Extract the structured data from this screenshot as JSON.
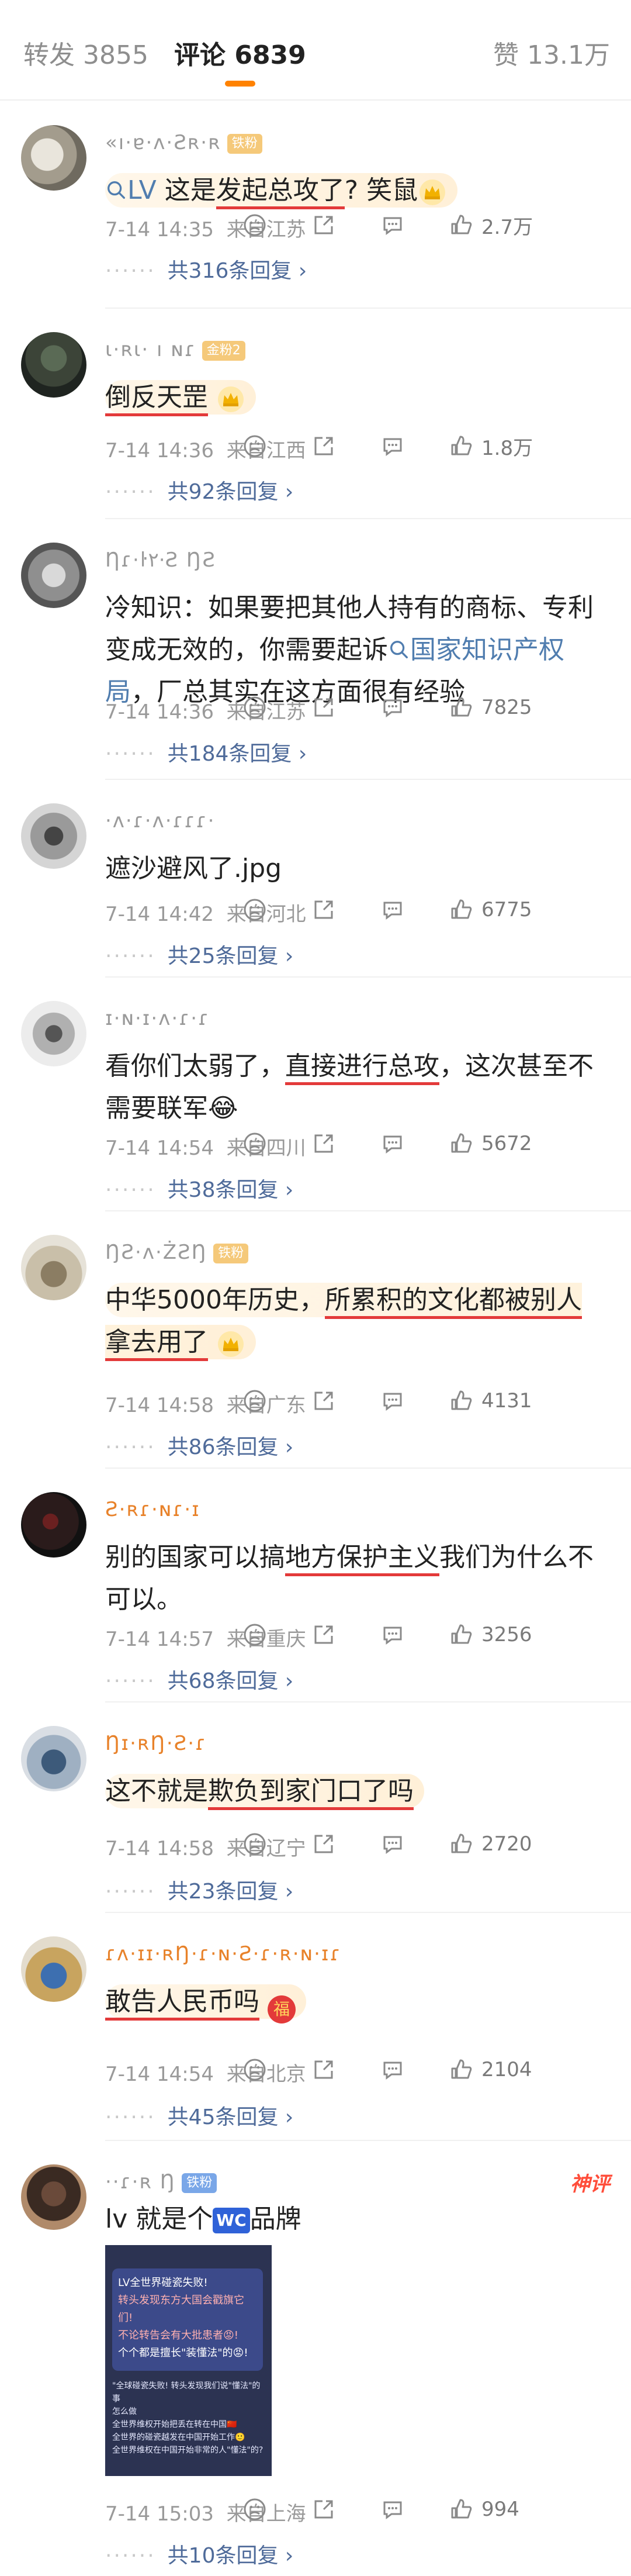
{
  "tabs": {
    "repost_label": "转发",
    "repost_count": "3855",
    "comment_label": "评论",
    "comment_count": "6839",
    "like_label": "赞",
    "like_count": "13.1万"
  },
  "comments": [
    {
      "username": "«ı·ɐ·ʌ·Ƨʀ·ʀ",
      "badge": "铁粉",
      "content": [
        "",
        "LV",
        " 这是",
        "发起总攻了",
        "? 笑鼠"
      ],
      "time": "7-14 14:35",
      "location": "来自江苏",
      "likes": "2.7万",
      "replies": "共316条回复 ›"
    },
    {
      "username": "ɩ·ʀɩ· ı ɴɾ",
      "badge": "金粉2",
      "content": [
        "倒反天罡"
      ],
      "time": "7-14 14:36",
      "location": "来自江西",
      "likes": "1.8万",
      "replies": "共92条回复 ›"
    },
    {
      "username": "Ƞɾ·ŀ٢·Ƨ  ŊƧ",
      "content": [
        "冷知识：如果要把其他人持有的商标、专利变成无效的，你需要起诉",
        "国家知识产权局",
        "，厂总其实在这方面很有经验"
      ],
      "time": "7-14 14:36",
      "location": "来自江苏",
      "likes": "7825",
      "replies": "共184条回复 ›"
    },
    {
      "username": "·ʌ·ɾ·ʌ·ɾɾɾ·",
      "content": [
        "遮沙避风了.jpg"
      ],
      "time": "7-14 14:42",
      "location": "来自河北",
      "likes": "6775",
      "replies": "共25条回复 ›"
    },
    {
      "username": "ɪ·ɴ·ɪ·ʌ·ɾ·ɾ",
      "content": [
        "看你们太弱了，",
        "直接进行总攻",
        "，这次甚至不需要联军😂"
      ],
      "time": "7-14 14:54",
      "location": "来自四川",
      "likes": "5672",
      "replies": "共38条回复 ›"
    },
    {
      "username": "ŊƧ·ʌ·ŻƧŊ",
      "badge": "铁粉",
      "content": [
        "中华5000年历史，",
        "所累积的文化都被别人拿去用了"
      ],
      "time": "7-14 14:58",
      "location": "来自广东",
      "likes": "4131",
      "replies": "共86条回复 ›"
    },
    {
      "username": "Ƨ·ʀɾ·ɴɾ·ɪ",
      "content": [
        "别的国家可以搞",
        "地方保护主义",
        "我们为什么不可以。"
      ],
      "time": "7-14 14:57",
      "location": "来自重庆",
      "likes": "3256",
      "replies": "共68条回复 ›"
    },
    {
      "username": "Ŋɪ·ʀŊ·Ƨ·ɾ",
      "content": [
        "这不就是",
        "欺负到家门口了吗"
      ],
      "time": "7-14 14:58",
      "location": "来自辽宁",
      "likes": "2720",
      "replies": "共23条回复 ›"
    },
    {
      "username": "ɾʌ·ɪɪ·ʀŊ·ɾ·ɴ·Ƨ·ɾ·ʀ·ɴ·ɪɾ",
      "content": [
        "敢告人民币吗"
      ],
      "time": "7-14 14:54",
      "location": "来自北京",
      "likes": "2104",
      "replies": "共45条回复 ›"
    },
    {
      "username": "··ɾ·ʀ Ŋ",
      "badge": "铁粉",
      "tag": "神评",
      "content": [
        "lv 就是个",
        "WC",
        "品牌"
      ],
      "image_text": {
        "lines": [
          "LV全世界碰瓷失败!",
          "转头发现东方大国会戳旗它们!",
          "不论转告会有大批患者😡!",
          "个个都是擅长\"装懂法\"的😡!"
        ],
        "caption": [
          "\"全球碰瓷失败! 转头发现我们说\"懂法\"的事",
          "怎么做",
          "全世界维权开始把丢在转在中国🇨🇳",
          "全世界的碰瓷越发在中国开始工作🙂",
          "全世界维权在中国开始非常的人\"懂法\"的?"
        ]
      },
      "time": "7-14 15:03",
      "location": "来自上海",
      "likes": "994",
      "replies": "共10条回复 ›"
    }
  ]
}
